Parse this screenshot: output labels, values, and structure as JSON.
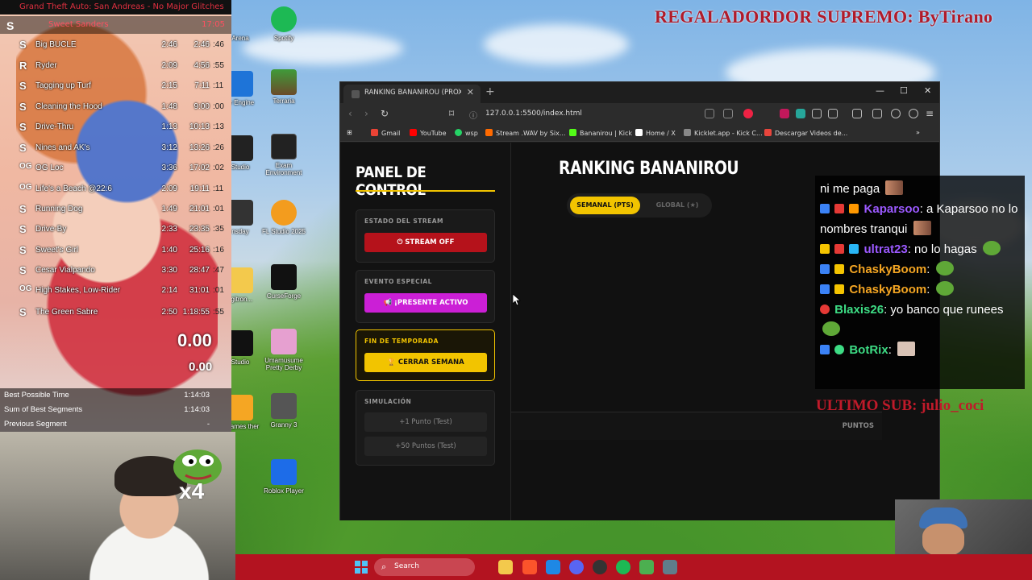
{
  "overlay": {
    "regalador": "REGALADORDOR SUPREMO: ByTirano",
    "ultimo_sub": "ULTIMO SUB: julio_coci"
  },
  "splits": {
    "title": "Grand Theft Auto: San Andreas - No Major Glitches",
    "runner_name": "Sweet Sanders",
    "runner_time1": "",
    "runner_time2": "17:05",
    "rows": [
      {
        "icon": "S",
        "name": "Big BUCLE",
        "delta": "2:46",
        "cumulative": "2:46",
        "extra": ":46"
      },
      {
        "icon": "R",
        "name": "Ryder",
        "delta": "2:09",
        "cumulative": "4:56",
        "extra": ":55"
      },
      {
        "icon": "S",
        "name": "Tagging up Turf",
        "delta": "2:15",
        "cumulative": "7:11",
        "extra": ":11"
      },
      {
        "icon": "S",
        "name": "Cleaning the Hood",
        "delta": "1:48",
        "cumulative": "9:00",
        "extra": ":00"
      },
      {
        "icon": "S",
        "name": "Drive-Thru",
        "delta": "1:13",
        "cumulative": "10:13",
        "extra": ":13"
      },
      {
        "icon": "S",
        "name": "Nines and AK's",
        "delta": "3:12",
        "cumulative": "13:26",
        "extra": ":26"
      },
      {
        "icon": "OG",
        "name": "OG Loc",
        "delta": "3:36",
        "cumulative": "17:02",
        "extra": ":02"
      },
      {
        "icon": "OG",
        "name": "Life's a Beach @22:6",
        "delta": "2:09",
        "cumulative": "19:11",
        "extra": ":11"
      },
      {
        "icon": "S",
        "name": "Running Dog",
        "delta": "1:49",
        "cumulative": "21:01",
        "extra": ":01"
      },
      {
        "icon": "S",
        "name": "Drive-By",
        "delta": "2:33",
        "cumulative": "23:35",
        "extra": ":35"
      },
      {
        "icon": "S",
        "name": "Sweet's Girl",
        "delta": "1:40",
        "cumulative": "25:16",
        "extra": ":16"
      },
      {
        "icon": "S",
        "name": "Cesar Vialpando",
        "delta": "3:30",
        "cumulative": "28:47",
        "extra": ":47"
      },
      {
        "icon": "OG",
        "name": "High Stakes, Low-Rider",
        "delta": "2:14",
        "cumulative": "31:01",
        "extra": ":01"
      },
      {
        "icon": "S",
        "name": "The Green Sabre",
        "delta": "2:50",
        "cumulative": "1:18:55",
        "extra": ":55"
      }
    ],
    "timer_big": "0.00",
    "timer_small": "0.00",
    "stats": [
      {
        "label": "Best Possible Time",
        "value": "1:14:03"
      },
      {
        "label": "Sum of Best Segments",
        "value": "1:14:03"
      },
      {
        "label": "Previous Segment",
        "value": "-"
      }
    ]
  },
  "webcam": {
    "emote_multiplier": "x4"
  },
  "desktop_icons": [
    {
      "label": "Spotify",
      "icon": "spotify-icon",
      "color": "#1db954"
    },
    {
      "label": "Terraria",
      "icon": "terraria-icon",
      "color": "#3f9b3a"
    },
    {
      "label": "Exam Environment",
      "icon": "exam-environment-icon",
      "color": "#222222"
    },
    {
      "label": "FL Studio 2025",
      "icon": "fl-studio-icon",
      "color": "#f39c1e"
    },
    {
      "label": "CurseForge",
      "icon": "curseforge-icon",
      "color": "#111111"
    },
    {
      "label": "Umamusume Pretty Derby",
      "icon": "umamusume-icon",
      "color": "#e6a0d0"
    },
    {
      "label": "Granny 3",
      "icon": "granny-icon",
      "color": "#555555"
    },
    {
      "label": "Roblox Player",
      "icon": "roblox-icon",
      "color": "#1d6ce8"
    }
  ],
  "desktop_partial_labels": [
    "Arena",
    "er Engine",
    "Studio",
    "nsday",
    "ligitron...",
    "Studio",
    "r Games ther",
    "al"
  ],
  "browser": {
    "tab_title": "RANKING BANANIROU (PROXY",
    "url": "127.0.0.1:5500/index.html",
    "bookmarks": [
      {
        "label": "Gmail",
        "color": "#ea4335"
      },
      {
        "label": "YouTube",
        "color": "#ff0000"
      },
      {
        "label": "wsp",
        "color": "#25d366"
      },
      {
        "label": "Stream .WAV by Six...",
        "color": "#ff6a00"
      },
      {
        "label": "Bananirou | Kick",
        "color": "#53fc18"
      },
      {
        "label": "Home / X",
        "color": "#ffffff"
      },
      {
        "label": "Kicklet.app - Kick C...",
        "color": "#888888"
      },
      {
        "label": "Descargar Videos de...",
        "color": "#e8453c"
      }
    ]
  },
  "panel": {
    "title": "PANEL DE CONTROL",
    "sections": {
      "stream": {
        "header": "ESTADO DEL STREAM",
        "button": "STREAM OFF"
      },
      "evento": {
        "header": "EVENTO ESPECIAL",
        "button": "¡PRESENTE ACTIVO"
      },
      "temporada": {
        "header": "FIN DE TEMPORADA",
        "button": "CERRAR SEMANA"
      },
      "simulacion": {
        "header": "SIMULACIÓN",
        "button1": "+1 Punto (Test)",
        "button2": "+50 Puntos (Test)"
      }
    }
  },
  "ranking": {
    "title": "RANKING BANANIROU",
    "toggle_active": "SEMANAL (PTS)",
    "toggle_inactive": "GLOBAL (★)",
    "column_points": "PUNTOS"
  },
  "chat": {
    "messages": [
      {
        "user": "",
        "user_color": "#ffffff",
        "text": "ni me paga"
      },
      {
        "user": "Kaparsoo",
        "user_color": "#9b59ff",
        "text": ": a Kaparsoo no lo nombres tranqui"
      },
      {
        "user": "ultrat23",
        "user_color": "#9b59ff",
        "text": ": no lo hagas"
      },
      {
        "user": "ChaskyBoom",
        "user_color": "#f5a623",
        "text": ":"
      },
      {
        "user": "ChaskyBoom",
        "user_color": "#f5a623",
        "text": ":"
      },
      {
        "user": "Blaxis26",
        "user_color": "#3ddc84",
        "text": ": yo banco que runees"
      },
      {
        "user": "BotRix",
        "user_color": "#3ddc84",
        "text": ":"
      }
    ]
  },
  "taskbar": {
    "search_placeholder": "Search"
  }
}
